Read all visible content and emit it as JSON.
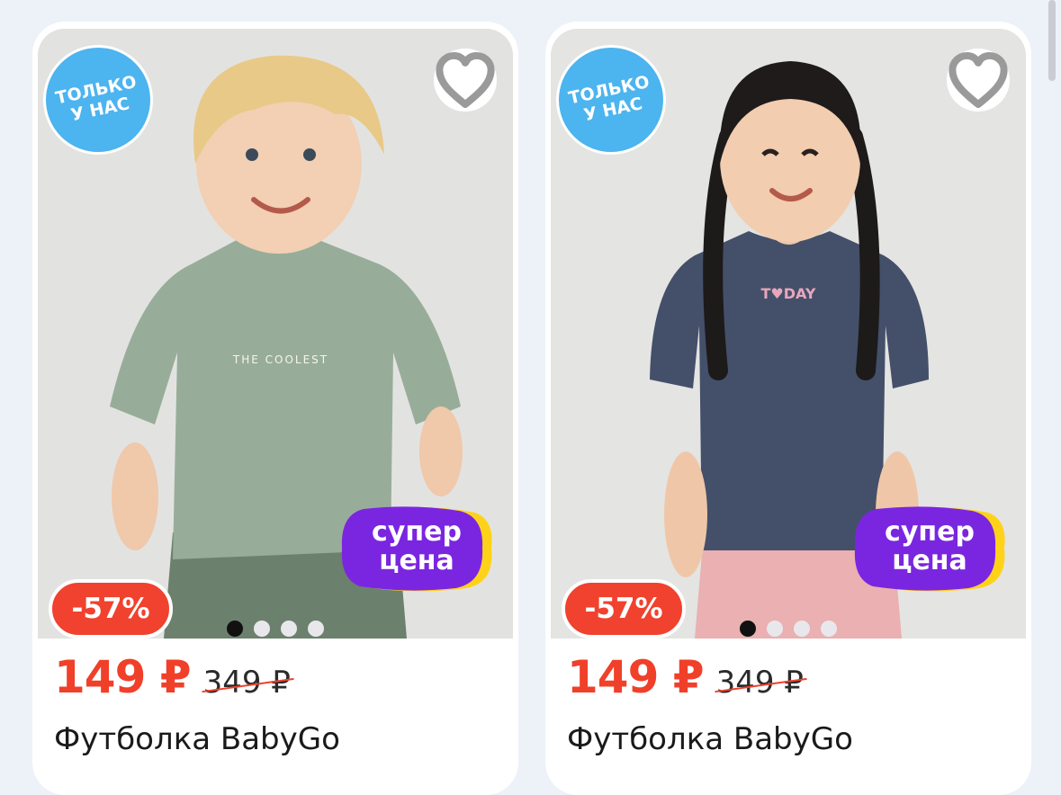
{
  "products": [
    {
      "badge_exclusive_line1": "ТОЛЬКО",
      "badge_exclusive_line2": "У НАС",
      "super_price_line1": "супер",
      "super_price_line2": "цена",
      "discount": "-57%",
      "price_new": "149 ₽",
      "price_old": "349 ₽",
      "title": "Футболка BabyGo",
      "shirt_print": "THE COOLEST",
      "carousel_total": 4,
      "carousel_active": 1,
      "shirt_color": "#98ad99",
      "pants_color": "#6c806e"
    },
    {
      "badge_exclusive_line1": "ТОЛЬКО",
      "badge_exclusive_line2": "У НАС",
      "super_price_line1": "супер",
      "super_price_line2": "цена",
      "discount": "-57%",
      "price_new": "149 ₽",
      "price_old": "349 ₽",
      "title": "Футболка BabyGo",
      "shirt_print": "T♥DAY",
      "carousel_total": 4,
      "carousel_active": 1,
      "shirt_color": "#44506a",
      "pants_color": "#eab0b2"
    }
  ],
  "colors": {
    "accent_red": "#f0402a",
    "badge_blue": "#4cb4ef",
    "super_purple": "#7a26e0",
    "super_yellow": "#ffd21a"
  },
  "icons": [
    "heart-outline-icon"
  ]
}
